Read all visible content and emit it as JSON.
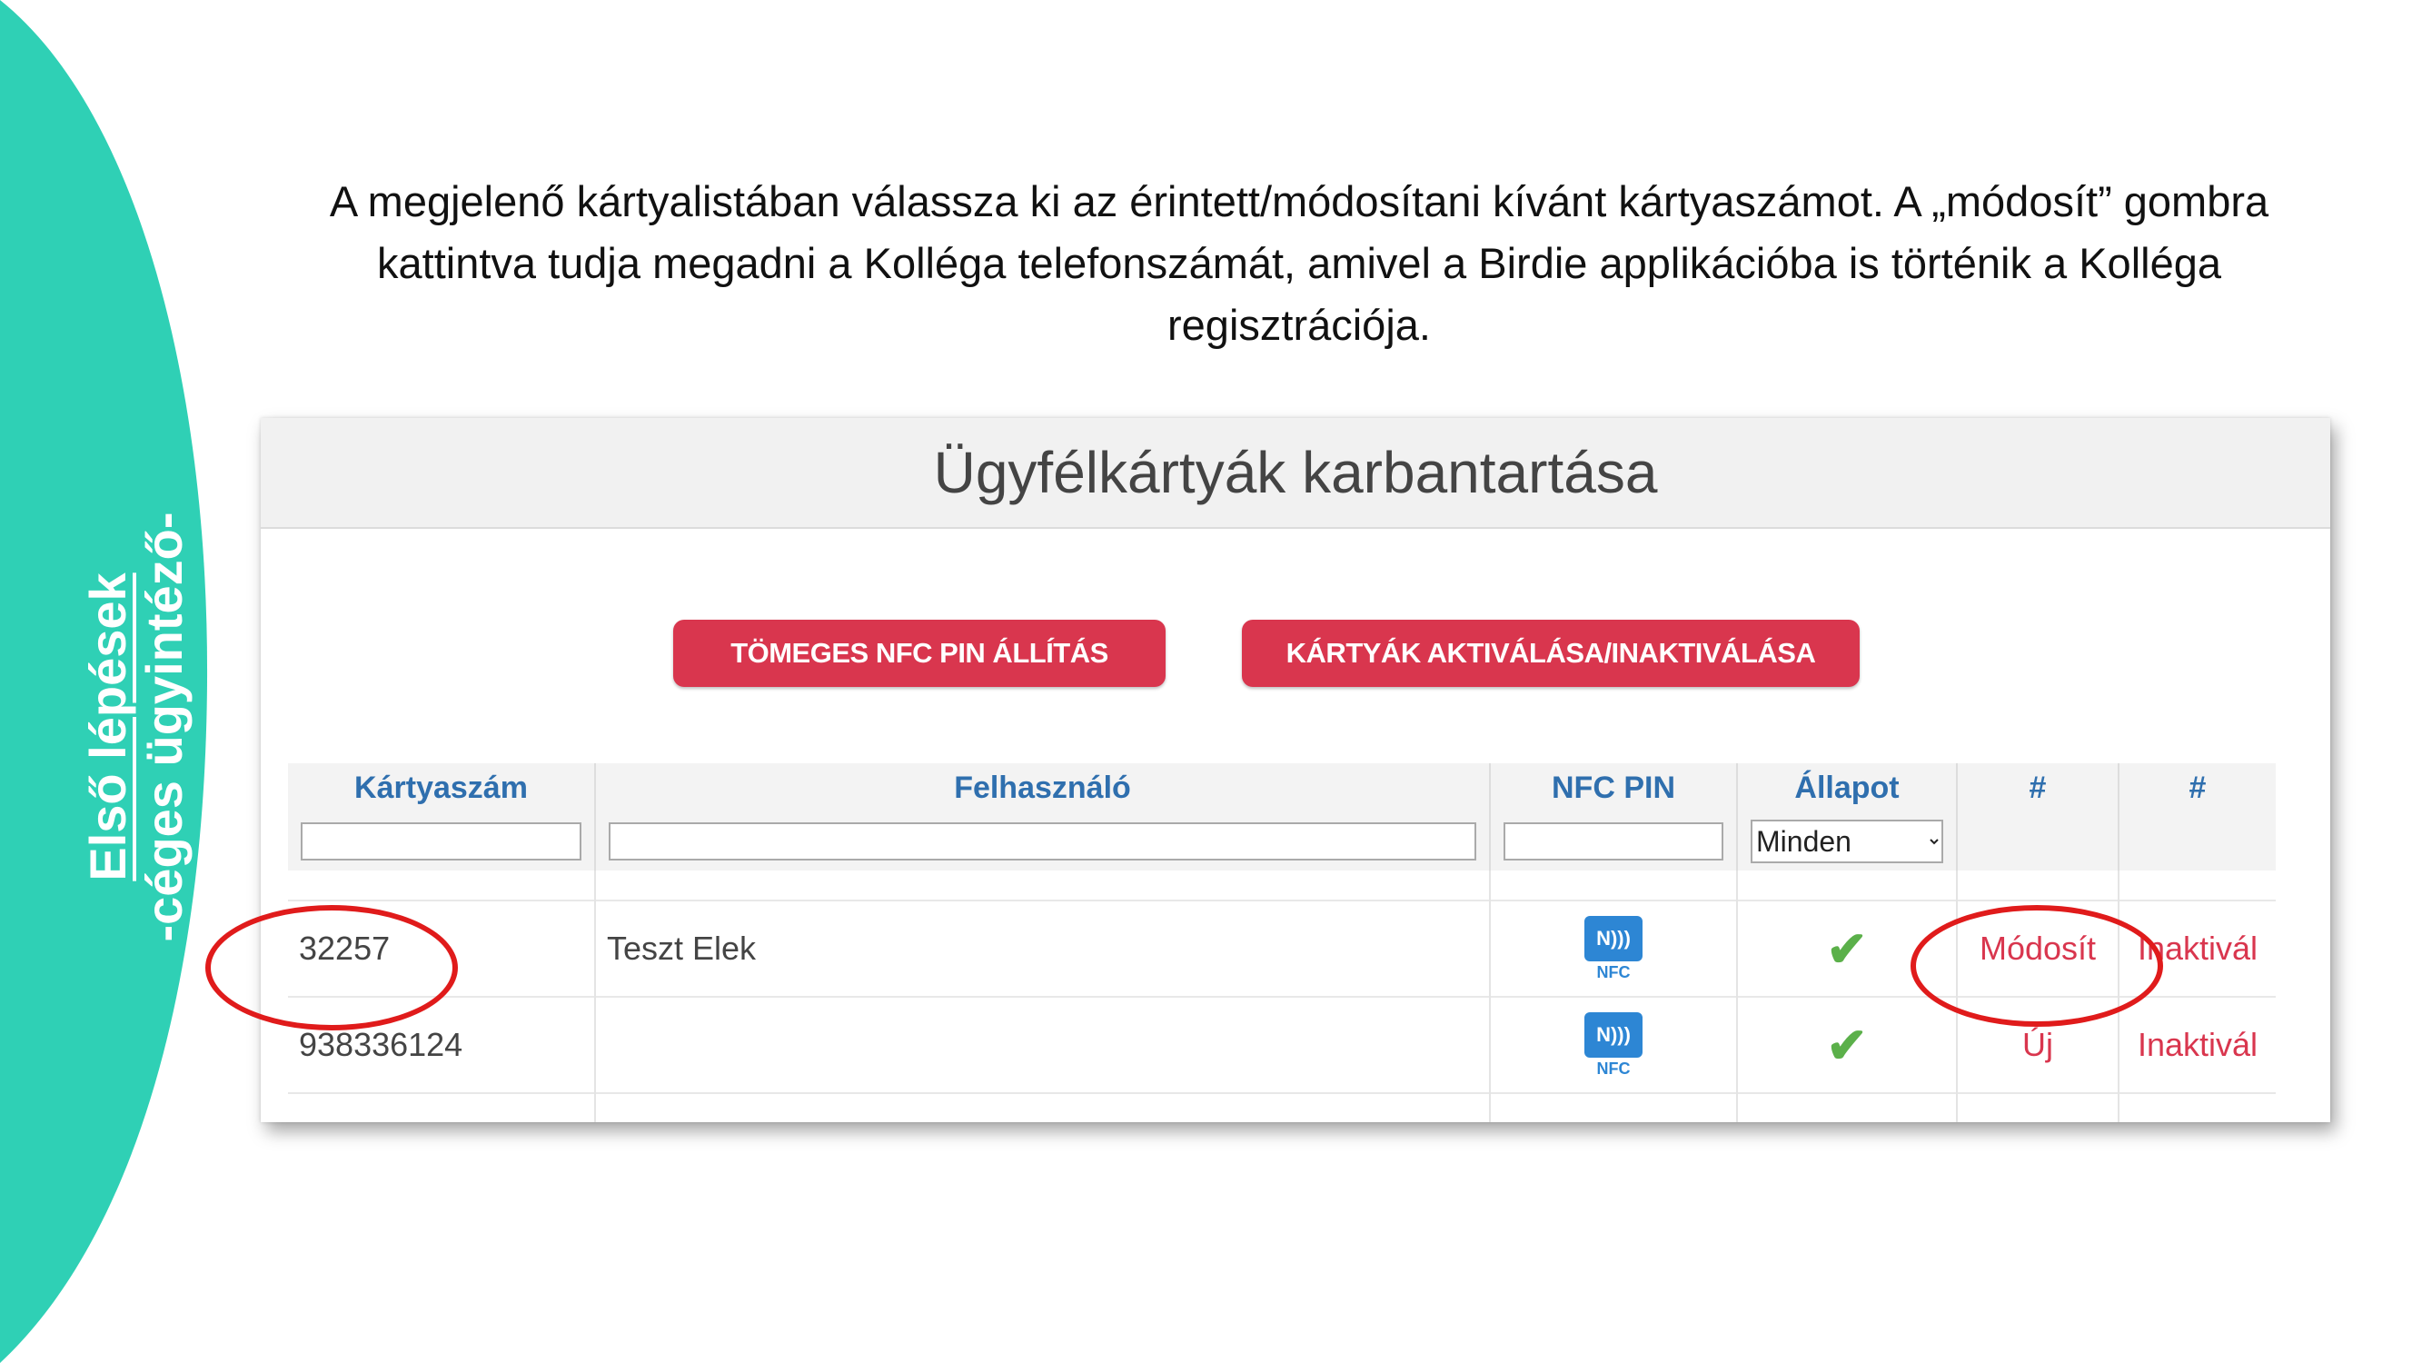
{
  "slide": {
    "side_title_line1": "Első lépések",
    "side_title_line2": "-céges ügyintéző-",
    "instruction": "A megjelenő kártyalistában válassza ki az érintett/módosítani kívánt kártyaszámot. A „módosít” gombra kattintva tudja megadni a Kolléga telefonszámát, amivel a Birdie applikációba is történik a Kolléga regisztrációja.",
    "accent_color": "#2fd0b5"
  },
  "app": {
    "title": "Ügyfélkártyák karbantartása",
    "buttons": {
      "bulk_nfc_pin": "TÖMEGES NFC PIN ÁLLÍTÁS",
      "activate_cards": "KÁRTYÁK AKTIVÁLÁSA/INAKTIVÁLÁSA"
    },
    "table": {
      "headers": [
        "Kártyaszám",
        "Felhasználó",
        "NFC PIN",
        "Állapot",
        "#",
        "#"
      ],
      "filters": {
        "card_number": "",
        "user": "",
        "nfc_pin": "",
        "status_selected": "Minden"
      },
      "rows": [
        {
          "card_number": "32257",
          "user": "Teszt Elek",
          "nfc_icon": "nfc-icon",
          "nfc_label": "NFC",
          "status_icon": "check-icon",
          "action1": "Módosít",
          "action2": "Inaktivál"
        },
        {
          "card_number": "938336124",
          "user": "",
          "nfc_icon": "nfc-icon",
          "nfc_label": "NFC",
          "status_icon": "check-icon",
          "action1": "Új",
          "action2": "Inaktivál"
        }
      ]
    },
    "colors": {
      "primary_button": "#d9364e",
      "header_text": "#2f6fae",
      "highlight": "#e01b1b"
    }
  }
}
